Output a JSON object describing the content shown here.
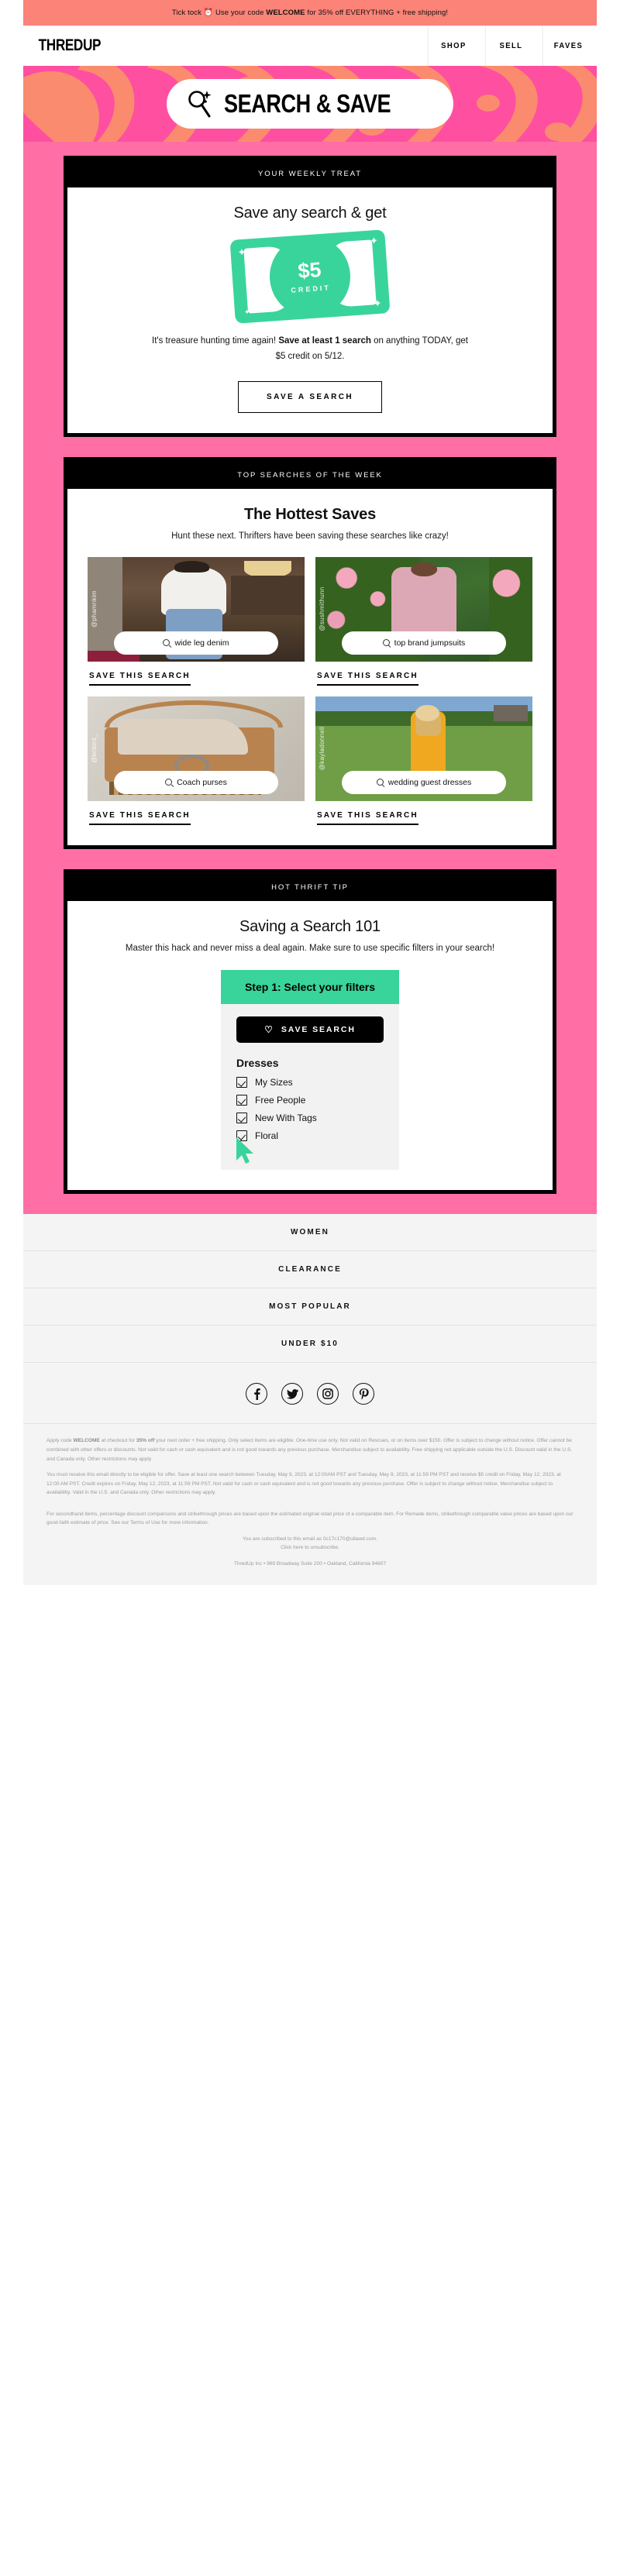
{
  "promo": {
    "pre": "Tick tock ",
    "icon": "⏰",
    "mid": " Use your code ",
    "code": "WELCOME",
    "post": " for 35% off EVERYTHING + free shipping!"
  },
  "nav": {
    "brand": "THREDUP",
    "links": [
      "SHOP",
      "SELL",
      "FAVES"
    ]
  },
  "hero": {
    "title": "SEARCH & SAVE",
    "icon": "search-sparkle-icon"
  },
  "card_treat": {
    "eyebrow": "YOUR WEEKLY TREAT",
    "heading": "Save any search & get",
    "bill": {
      "amount": "$5",
      "label": "CREDIT"
    },
    "copy_a": "It's treasure hunting time again! ",
    "copy_b": "Save at least 1 search",
    "copy_c": " on anything TODAY, get $5 credit on 5/12.",
    "cta": "SAVE A SEARCH"
  },
  "card_top": {
    "eyebrow": "TOP SEARCHES OF THE WEEK",
    "heading": "The Hottest Saves",
    "sub": "Hunt these next. Thrifters have been saving these searches like crazy!",
    "save_label": "SAVE THIS SEARCH",
    "tiles": [
      {
        "query": "wide leg denim",
        "watermark": "@phamnkim"
      },
      {
        "query": "top brand jumpsuits",
        "watermark": "@sushmithunn"
      },
      {
        "query": "Coach purses",
        "watermark": "@bribird_"
      },
      {
        "query": "wedding guest dresses",
        "watermark": "@kayladonnell"
      }
    ]
  },
  "card_tip": {
    "eyebrow": "HOT THRIFT TIP",
    "heading": "Saving a Search 101",
    "sub": "Master this hack and never miss a deal again. Make sure to use specific filters in your search!",
    "step_label": "Step 1: Select your filters",
    "save_button": "SAVE SEARCH",
    "filter_title": "Dresses",
    "filters": [
      "My Sizes",
      "Free People",
      "New With Tags",
      "Floral"
    ]
  },
  "footer": {
    "links": [
      "WOMEN",
      "CLEARANCE",
      "MOST POPULAR",
      "UNDER $10"
    ],
    "social": [
      "facebook-icon",
      "twitter-icon",
      "instagram-icon",
      "pinterest-icon"
    ],
    "legal_1_a": "Apply code ",
    "legal_1_b": "WELCOME",
    "legal_1_c": " at checkout for ",
    "legal_1_d": "35% off",
    "legal_1_e": " your next order + free shipping. Only select items are eligible. One-time use only. Not valid on Rescues, or on items over $150. Offer is subject to change without notice. Offer cannot be combined with other offers or discounts. Not valid for cash or cash equivalent and is not good towards any previous purchase. Merchandise subject to availability. Free shipping not applicable outside the U.S. Discount valid in the U.S. and Canada only. Other restrictions may apply",
    "legal_2": "You must receive this email directly to be eligible for offer. Save at least one search between Tuesday, May 9, 2023, at 12:00AM PST and Tuesday, May 9, 2023, at 11:59 PM PST and receive $5 credit on Friday, May 12, 2023, at 12:00 AM PST. Credit expires on Friday, May 12, 2023, at 11:59 PM PST. Not valid for cash or cash equivalent and is not good towards any previous purchase. Offer is subject to change without notice. Merchandise subject to availability. Valid in the U.S. and Canada only. Other restrictions may apply.",
    "legal_3": "For secondhand items, percentage discount comparisons and strikethrough prices are based upon the estimated original retail price of a comparable item. For Remade items, strikethrough comparable value prices are based upon our good-faith estimate of price. See our Terms of Use for more information.",
    "unsub_1": "You are subscribed to this email as 0c17c170@ullawd.com.",
    "unsub_2": "Click here to unsubscribe.",
    "address": "ThredUp Inc • 969 Broadway Suite 200 • Oakland, California 94607"
  }
}
